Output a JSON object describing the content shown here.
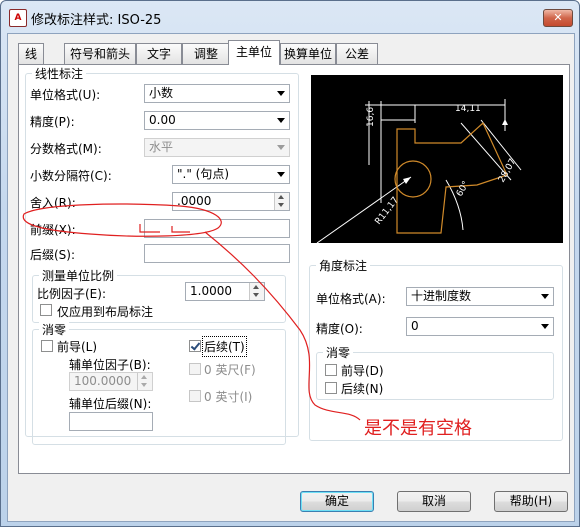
{
  "window": {
    "title": "修改标注样式: ISO-25",
    "close_label": "✕"
  },
  "tabs": [
    {
      "label": "线"
    },
    {
      "label": "符号和箭头"
    },
    {
      "label": "文字"
    },
    {
      "label": "调整"
    },
    {
      "label": "主单位",
      "active": true
    },
    {
      "label": "换算单位"
    },
    {
      "label": "公差"
    }
  ],
  "linear": {
    "group_label": "线性标注",
    "unit_format_label": "单位格式(U):",
    "unit_format_value": "小数",
    "precision_label": "精度(P):",
    "precision_value": "0.00",
    "fraction_label": "分数格式(M):",
    "fraction_value": "水平",
    "decimal_sep_label": "小数分隔符(C):",
    "decimal_sep_value": "\".\" (句点)",
    "round_label": "舍入(R):",
    "round_value": ".0000",
    "prefix_label": "前缀(X):",
    "prefix_value": "",
    "suffix_label": "后缀(S):",
    "suffix_value": ""
  },
  "scale": {
    "group_label": "测量单位比例",
    "factor_label": "比例因子(E):",
    "factor_value": "1.0000",
    "layout_only_label": "仅应用到布局标注"
  },
  "zero_linear": {
    "group_label": "消零",
    "leading_label": "前导(L)",
    "trailing_label": "后续(T)",
    "trailing_checked": true,
    "subunit_factor_label": "辅单位因子(B):",
    "subunit_factor_value": "100.0000",
    "feet_label": "0 英尺(F)",
    "subunit_suffix_label": "辅单位后缀(N):",
    "subunit_suffix_value": "",
    "inches_label": "0 英寸(I)"
  },
  "angular": {
    "group_label": "角度标注",
    "unit_format_label": "单位格式(A):",
    "unit_format_value": "十进制度数",
    "precision_label": "精度(O):",
    "precision_value": "0",
    "zero_group_label": "消零",
    "leading_label": "前导(D)",
    "trailing_label": "后续(N)"
  },
  "preview": {
    "dim_top": "14,11",
    "dim_left": "16,6",
    "dim_right": "28,07",
    "dim_angle": "60°",
    "dim_radius": "R11,17"
  },
  "buttons": {
    "ok": "确定",
    "cancel": "取消",
    "help": "帮助(H)"
  },
  "annotation": {
    "text": "是不是有空格",
    "color": "#e02020"
  }
}
